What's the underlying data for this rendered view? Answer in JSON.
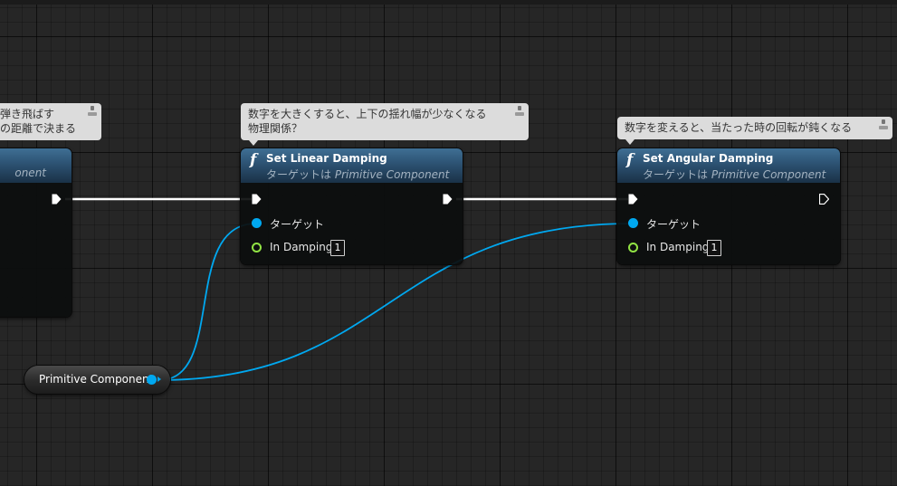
{
  "comments": {
    "left_line1": "弾き飛ばす",
    "left_line2": "の距離で決まる",
    "middle_line1": "数字を大きくすると、上下の揺れ幅が少なくなる",
    "middle_line2": "物理関係？",
    "right_line1": "数字を変えると、当たった時の回転が鈍くなる"
  },
  "nodes": {
    "left": {
      "subtitle_suffix": "onent"
    },
    "linear": {
      "title": "Set Linear Damping",
      "subtitle_prefix": "ターゲットは ",
      "subtitle_class": "Primitive Component",
      "pin_target": "ターゲット",
      "pin_damping": "In Damping",
      "damping_value": "1"
    },
    "angular": {
      "title": "Set Angular Damping",
      "subtitle_prefix": "ターゲットは ",
      "subtitle_class": "Primitive Component",
      "pin_target": "ターゲット",
      "pin_damping": "In Damping",
      "damping_value": "1"
    },
    "variable": {
      "label": "Primitive Component"
    }
  },
  "icons": {
    "function": "function-icon",
    "comment_pin": "pin-icon",
    "exec": "exec-pin-icon",
    "object": "object-pin-icon",
    "float": "float-pin-icon"
  },
  "colors": {
    "background": "#262626",
    "exec_wire": "#ffffff",
    "object_wire": "#00a8f0",
    "float_pin": "#91e344",
    "header_blue": "#2e5576"
  }
}
